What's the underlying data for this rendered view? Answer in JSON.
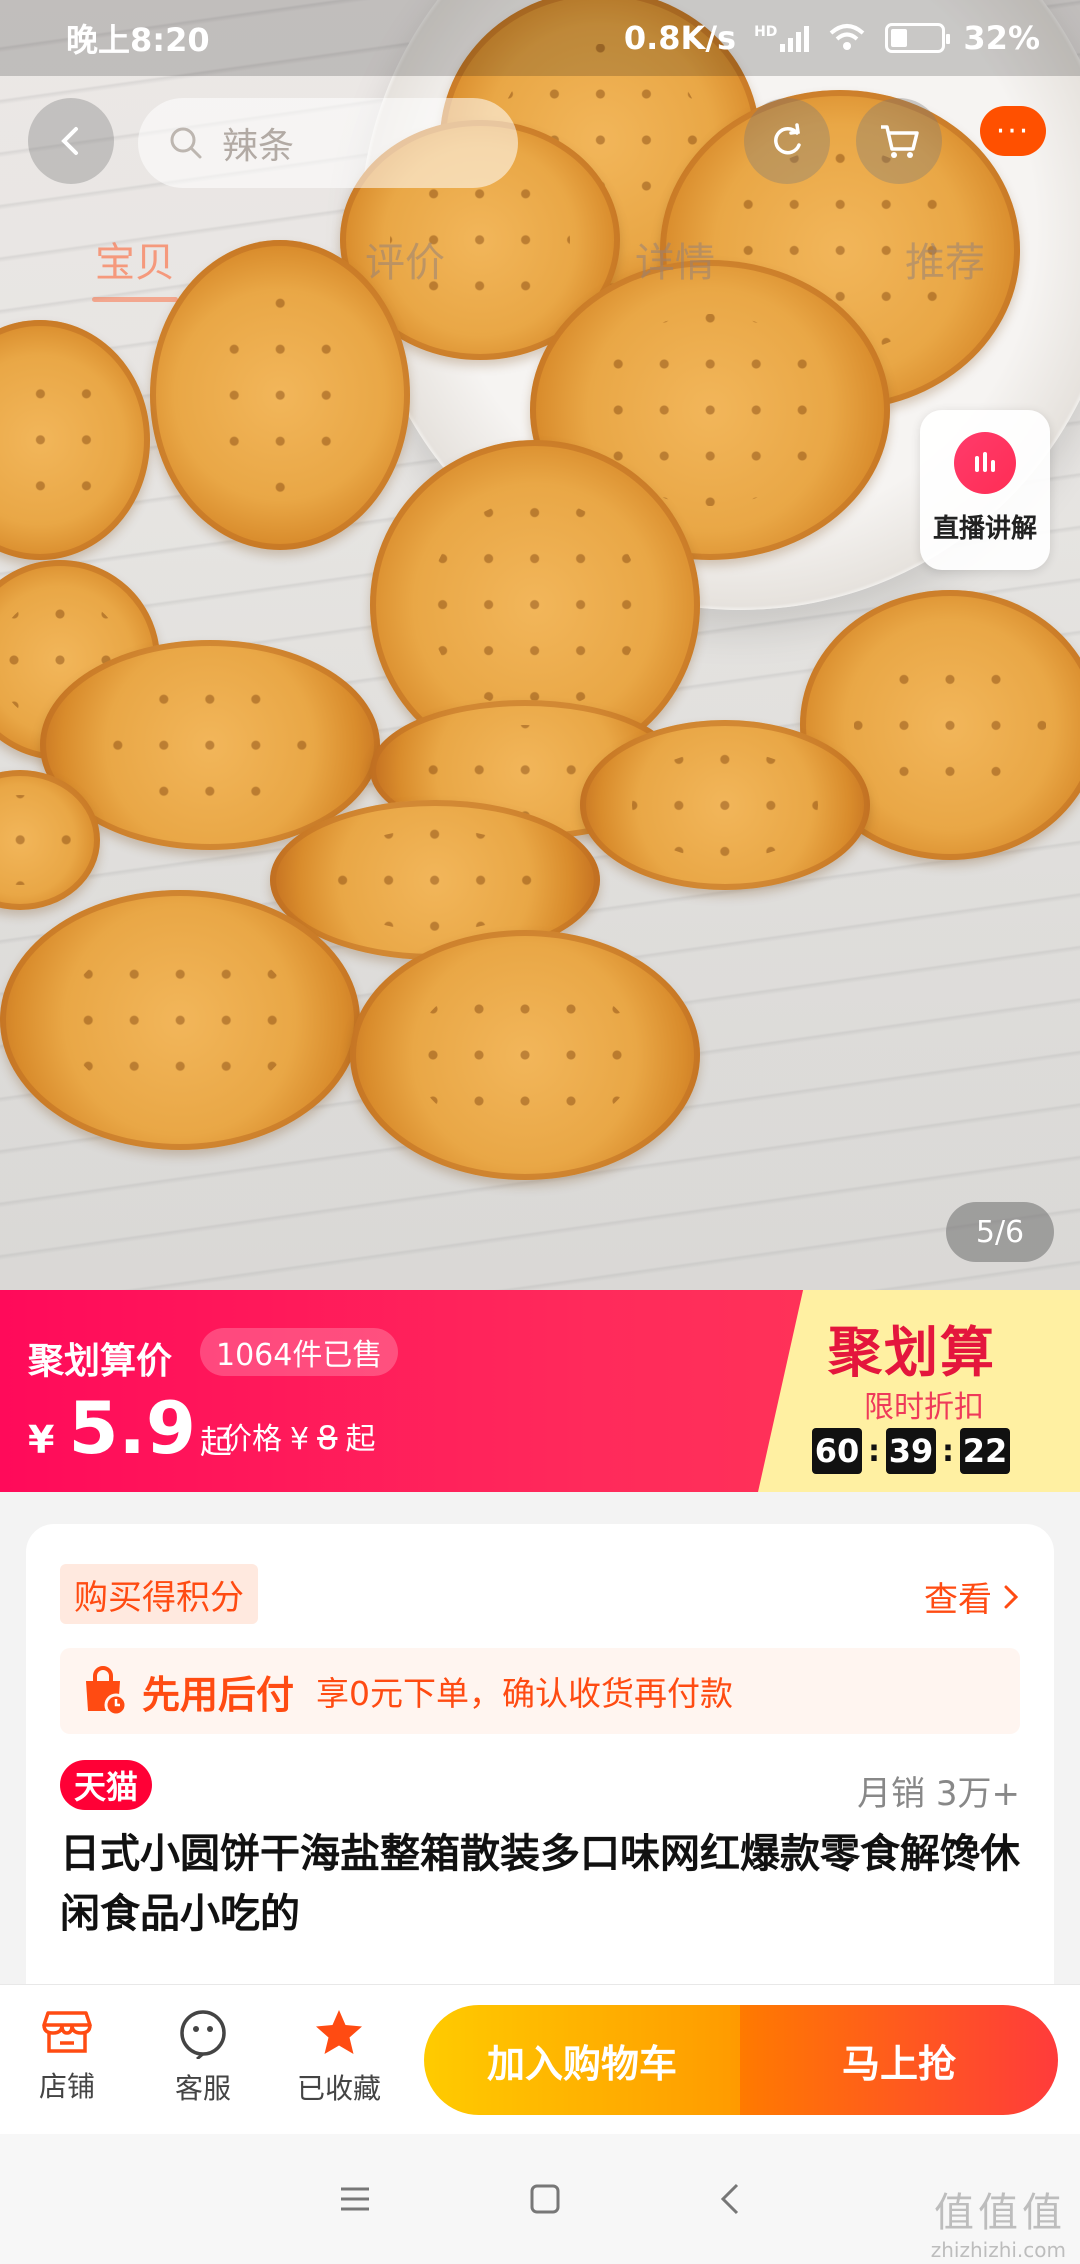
{
  "status_bar": {
    "time": "晚上8:20",
    "speed": "0.8K/s",
    "network": "HD",
    "battery": "32%"
  },
  "top_nav": {
    "search_placeholder": "辣条",
    "more_label": "···",
    "tabs": [
      "宝贝",
      "评价",
      "详情",
      "推荐"
    ],
    "active_tab": "宝贝"
  },
  "gallery": {
    "page_indicator": "5/6",
    "live_label": "直播讲解"
  },
  "promo": {
    "label": "聚划算价",
    "sold": "1064件已售",
    "currency": "¥",
    "price": "5.9",
    "price_suffix": "起",
    "orig_label": "价格",
    "orig_currency": "¥",
    "orig_price": "8",
    "orig_suffix": "起",
    "brand": "聚划算",
    "brand_sub": "限时折扣",
    "countdown": [
      "60",
      "39",
      "22"
    ],
    "colors": {
      "accent": "#ff0a5a",
      "brand": "#e4163d",
      "panel": "#fff0a2"
    }
  },
  "info": {
    "points_tag": "购买得积分",
    "view_label": "查看",
    "pay_later_title": "先用后付",
    "pay_later_desc": "享0元下单，确认收货再付款",
    "tmall_tag": "天猫",
    "monthly_sales": "月销 3万+",
    "product_title": "日式小圆饼干海盐整箱散装多口味网红爆款零食解馋休闲食品小吃的"
  },
  "bottom_bar": {
    "shop_label": "店铺",
    "service_label": "客服",
    "fav_label": "已收藏",
    "cart_button": "加入购物车",
    "buy_button": "马上抢"
  },
  "watermark": {
    "big": "值值值",
    "small": "zhizhizhi.com"
  }
}
